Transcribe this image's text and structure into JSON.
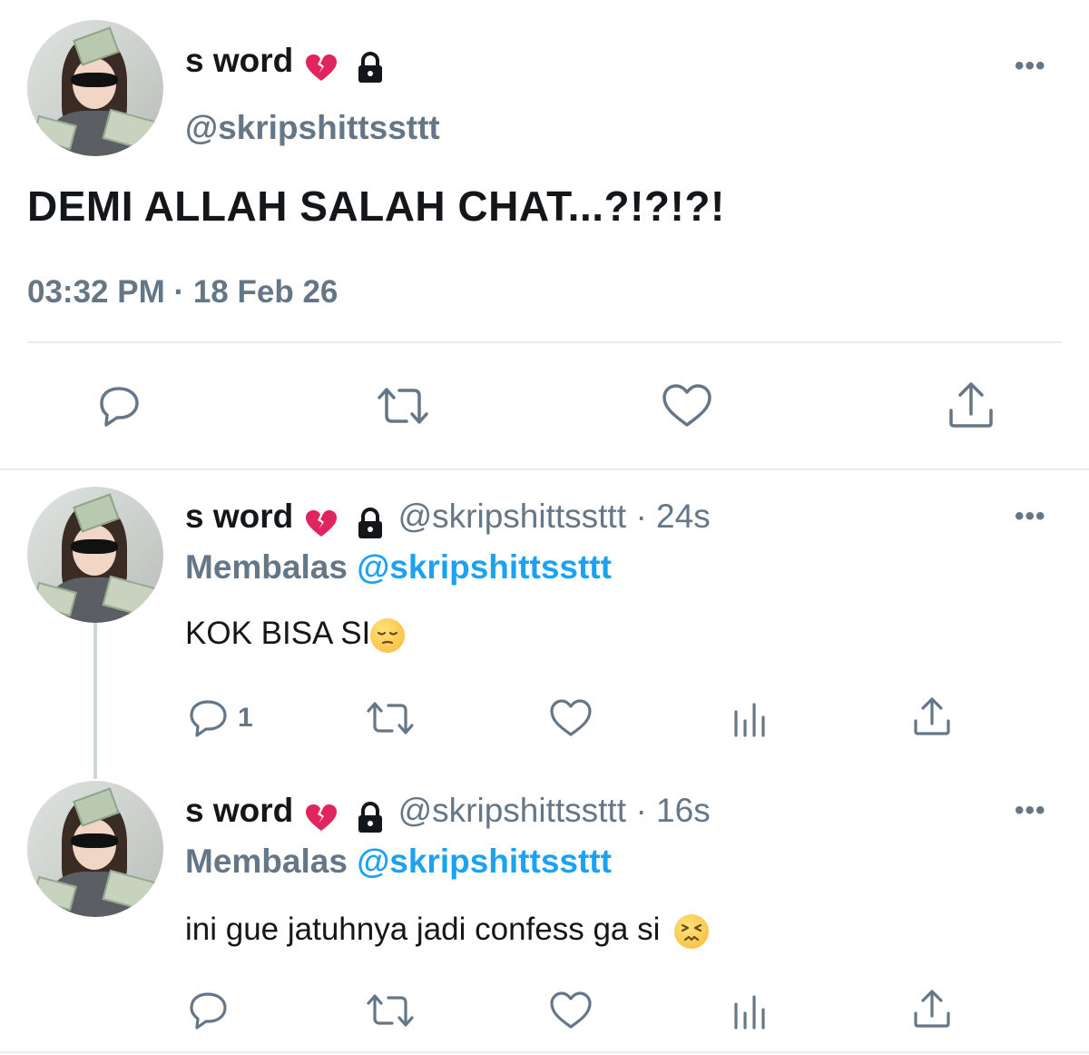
{
  "main_tweet": {
    "author_name": "s word",
    "author_handle": "@skripshittssttt",
    "text": "DEMI ALLAH SALAH CHAT...?!?!?!",
    "timestamp": "03:32 PM · 18 Feb 26",
    "more_label": "•••",
    "icons": [
      "reply-icon",
      "retweet-icon",
      "like-icon",
      "share-icon"
    ]
  },
  "replies": [
    {
      "author_name": "s word",
      "author_handle": "@skripshittssttt",
      "time_ago": "· 24s",
      "replying_prefix": "Membalas",
      "replying_to": "@skripshittssttt",
      "text": "KOK BISA SI",
      "emoji": "pensive-face",
      "reply_count": "1",
      "more_label": "•••"
    },
    {
      "author_name": "s word",
      "author_handle": "@skripshittssttt",
      "time_ago": "· 16s",
      "replying_prefix": "Membalas",
      "replying_to": "@skripshittssttt",
      "text": "ini gue jatuhnya jadi confess ga si",
      "emoji": "persevering-face",
      "reply_count": "",
      "more_label": "•••"
    }
  ],
  "colors": {
    "text": "#14171a",
    "secondary": "#657786",
    "accent": "#1da1f2",
    "divider": "#e6ecf0"
  }
}
